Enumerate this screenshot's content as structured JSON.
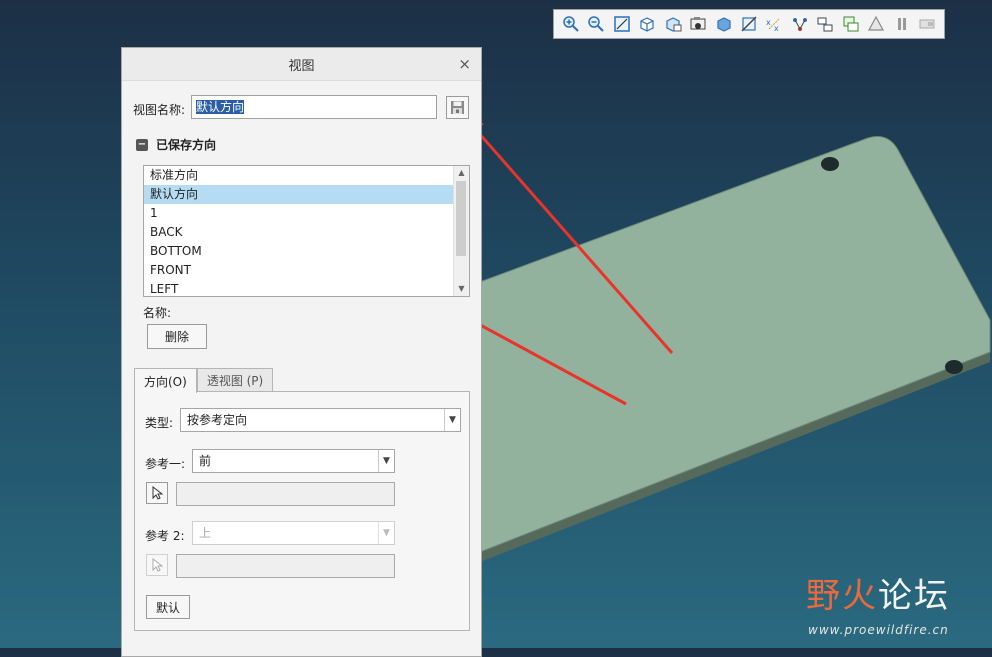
{
  "toolbar": {
    "icons": [
      "zoom-in-icon",
      "zoom-out-icon",
      "refit-icon",
      "cube-view-icon",
      "saved-views-icon",
      "render-camera-icon",
      "display-style-icon",
      "section-icon",
      "datum-points-icon",
      "axis-display-icon",
      "spin-center-icon",
      "annotation-icon",
      "warning-icon",
      "pause-icon",
      "next-icon"
    ]
  },
  "dialog": {
    "title": "视图",
    "close": "×",
    "view_name_label": "视图名称:",
    "view_name_value": "默认方向",
    "saved_section_toggle": "−",
    "saved_section_title": "已保存方向",
    "saved_list": [
      "标准方向",
      "默认方向",
      "1",
      "BACK",
      "BOTTOM",
      "FRONT",
      "LEFT"
    ],
    "selected_index": 1,
    "name_label": "名称:",
    "delete_button": "删除",
    "tabs": [
      {
        "label": "方向(O)",
        "active": true
      },
      {
        "label": "透视图 (P)",
        "active": false
      }
    ],
    "type_label": "类型:",
    "type_value": "按参考定向",
    "ref1_label": "参考一:",
    "ref1_value": "前",
    "ref2_label": "参考 2:",
    "ref2_value": "上",
    "default_button": "默认"
  },
  "watermark": {
    "brand_part1": "野火",
    "brand_part2": "论坛",
    "url": "www.proewildfire.cn"
  },
  "colors": {
    "accent_red": "#e8342a",
    "selection": "#b5dcf2",
    "plate": "#93b29d"
  }
}
